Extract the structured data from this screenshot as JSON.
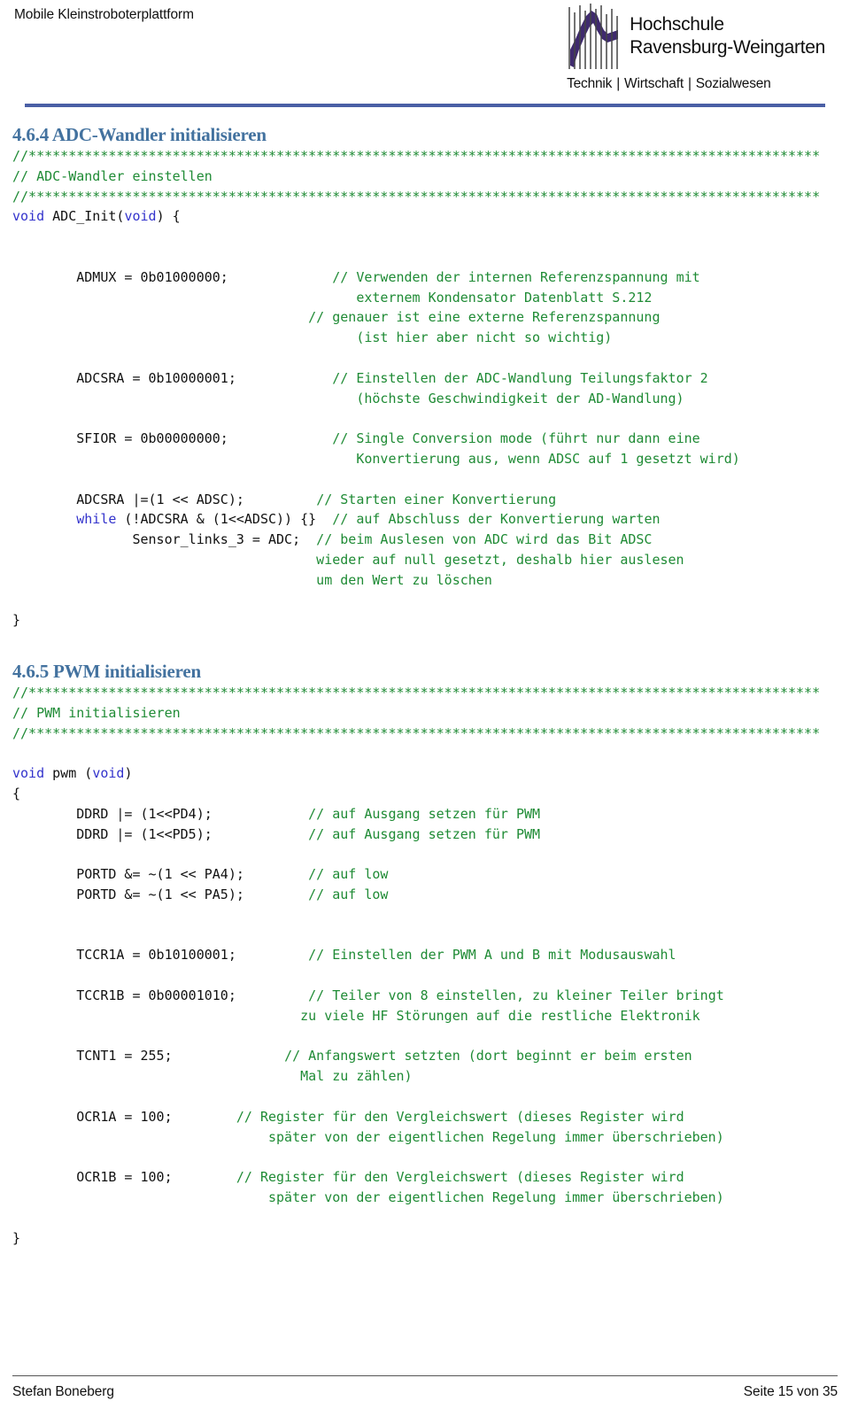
{
  "header": {
    "document_title": "Mobile Kleinstroboterplattform",
    "logo": {
      "line1": "Hochschule",
      "line2": "Ravensburg-Weingarten",
      "subtitle_parts": [
        "Technik",
        "Wirtschaft",
        "Sozialwesen"
      ],
      "separator": "|",
      "mark_color": "#3f2a6e"
    },
    "rule_color": "#4a5fa5"
  },
  "colors": {
    "heading": "#43729f",
    "comment_green": "#1f8b35",
    "keyword_blue": "#3333cc",
    "code_plain": "#111111",
    "rule_blue": "#4a5fa5"
  },
  "sections": [
    {
      "number": "4.6.4",
      "title": "4.6.4 ADC-Wandler initialisieren"
    },
    {
      "number": "4.6.5",
      "title": "4.6.5 PWM initialisieren"
    }
  ],
  "code": {
    "banner_rule": "//***************************************************************************************************",
    "adc": {
      "banner_comment": "// ADC-Wandler einstellen",
      "signature_kw": "void",
      "signature_name": " ADC_Init(",
      "signature_kw2": "void",
      "signature_tail": ") {",
      "statements": [
        {
          "code": "        ADMUX = 0b01000000;",
          "comments": [
            "// Verwenden der internen Referenzspannung mit",
            "   externem Kondensator Datenblatt S.212",
            "// genauer ist eine externe Referenzspannung",
            "   (ist hier aber nicht so wichtig)"
          ]
        },
        {
          "code": "        ADCSRA = 0b10000001;",
          "comments": [
            "// Einstellen der ADC-Wandlung Teilungsfaktor 2",
            "   (höchste Geschwindigkeit der AD-Wandlung)"
          ]
        },
        {
          "code": "        SFIOR = 0b00000000;",
          "comments": [
            "// Single Conversion mode (führt nur dann eine",
            "   Konvertierung aus, wenn ADSC auf 1 gesetzt wird)"
          ]
        }
      ],
      "tail_lines": [
        {
          "code": "        ADCSRA |=(1 << ADSC);",
          "comment": "// Starten einer Konvertierung"
        },
        {
          "code": "        while (!ADCSRA & (1<<ADSC)) {}",
          "comment": "// auf Abschluss der Konvertierung warten"
        },
        {
          "code": "               Sensor_links_3 = ADC;",
          "comment": "// beim Auslesen von ADC wird das Bit ADSC"
        },
        {
          "code": "",
          "comment": "wieder auf null gesetzt, deshalb hier auslesen"
        },
        {
          "code": "",
          "comment": "um den Wert zu löschen"
        }
      ],
      "closing_brace": "}"
    },
    "pwm": {
      "banner_comment": "// PWM initialisieren",
      "signature_kw": "void",
      "signature_name": " pwm (",
      "signature_kw2": "void",
      "signature_tail": ")",
      "open_brace": "{",
      "lines": [
        {
          "code": "        DDRD |= (1<<PD4);",
          "comment": "// auf Ausgang setzen für PWM"
        },
        {
          "code": "        DDRD |= (1<<PD5);",
          "comment": "// auf Ausgang setzen für PWM"
        },
        {
          "code": "        PORTD &= ~(1 << PA4);",
          "comment": "// auf low"
        },
        {
          "code": "        PORTD &= ~(1 << PA5);",
          "comment": "// auf low"
        },
        {
          "code": "        TCCR1A = 0b10100001;",
          "comment": "// Einstellen der PWM A und B mit Modusauswahl"
        },
        {
          "code": "        TCCR1B = 0b00001010;",
          "comment": "// Teiler von 8 einstellen, zu kleiner Teiler bringt"
        },
        {
          "code": "",
          "comment": "zu viele HF Störungen auf die restliche Elektronik"
        },
        {
          "code": "        TCNT1 = 255;",
          "comment": "// Anfangswert setzten (dort beginnt er beim ersten"
        },
        {
          "code": "",
          "comment": "Mal zu zählen)"
        },
        {
          "code": "        OCR1A = 100;",
          "comment": "// Register für den Vergleichswert (dieses Register wird"
        },
        {
          "code": "",
          "comment": "später von der eigentlichen Regelung immer überschrieben)"
        },
        {
          "code": "        OCR1B = 100;",
          "comment": "// Register für den Vergleichswert (dieses Register wird"
        },
        {
          "code": "",
          "comment": "später von der eigentlichen Regelung immer überschrieben)"
        }
      ],
      "closing_brace": "}"
    }
  },
  "footer": {
    "author": "Stefan Boneberg",
    "page_label": "Seite 15 von 35",
    "page_current": "15",
    "page_total": "35"
  }
}
